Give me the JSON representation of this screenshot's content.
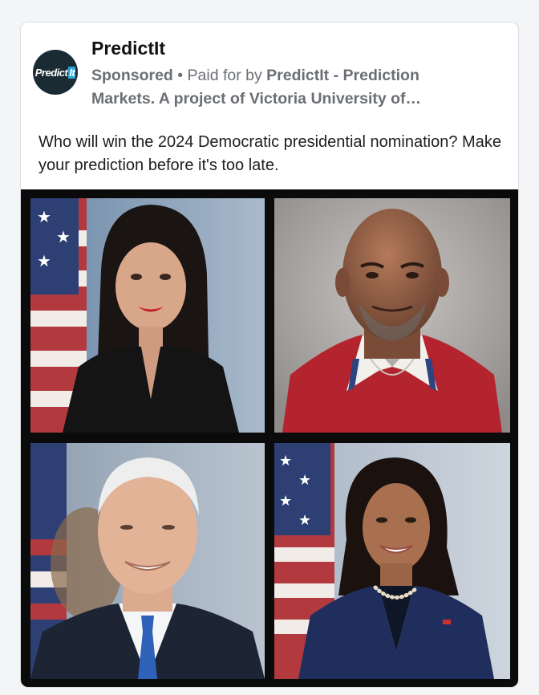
{
  "ad": {
    "page_name": "PredictIt",
    "avatar_logo_text": "Predict",
    "avatar_logo_suffix": "It",
    "sponsored_label": "Sponsored",
    "separator": " • ",
    "paid_for_prefix": "Paid for by ",
    "paid_for_line1": "PredictIt - Prediction",
    "paid_for_line2": "Markets. A project of Victoria University of…",
    "body_text": "Who will win the 2024 Democratic presidential nomination? Make your prediction before it's too late."
  },
  "image_grid": {
    "tiles": [
      {
        "name": "portrait-woman-dark-hair-black-blazer"
      },
      {
        "name": "portrait-bald-man-red-polo"
      },
      {
        "name": "portrait-white-haired-man-blue-tie"
      },
      {
        "name": "portrait-woman-navy-suit-pearls"
      }
    ]
  },
  "colors": {
    "card_bg": "#ffffff",
    "page_bg": "#f4f5f6",
    "meta_text": "#6b6f74",
    "avatar_bg": "#1b2b33",
    "logo_accent": "#2ea3d7",
    "grid_bg": "#0b0b0b"
  }
}
